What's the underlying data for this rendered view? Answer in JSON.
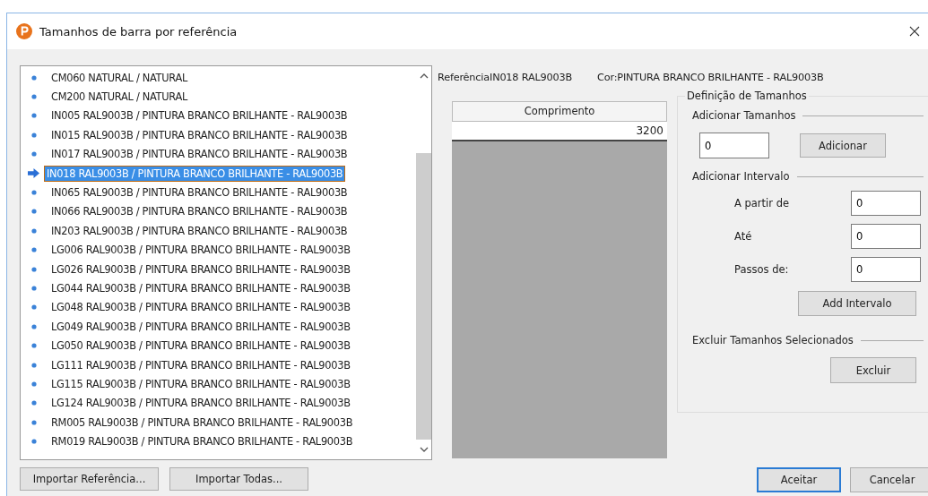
{
  "window": {
    "title": "Tamanhos de barra por referência"
  },
  "list": {
    "items": [
      {
        "label": "CM060 NATURAL / NATURAL",
        "selected": false
      },
      {
        "label": "CM200 NATURAL / NATURAL",
        "selected": false
      },
      {
        "label": "IN005 RAL9003B / PINTURA BRANCO BRILHANTE - RAL9003B",
        "selected": false
      },
      {
        "label": "IN015 RAL9003B / PINTURA BRANCO BRILHANTE - RAL9003B",
        "selected": false
      },
      {
        "label": "IN017 RAL9003B / PINTURA BRANCO BRILHANTE - RAL9003B",
        "selected": false
      },
      {
        "label": "IN018 RAL9003B / PINTURA BRANCO BRILHANTE - RAL9003B",
        "selected": true
      },
      {
        "label": "IN065 RAL9003B / PINTURA BRANCO BRILHANTE - RAL9003B",
        "selected": false
      },
      {
        "label": "IN066 RAL9003B / PINTURA BRANCO BRILHANTE - RAL9003B",
        "selected": false
      },
      {
        "label": "IN203 RAL9003B / PINTURA BRANCO BRILHANTE - RAL9003B",
        "selected": false
      },
      {
        "label": "LG006 RAL9003B / PINTURA BRANCO BRILHANTE - RAL9003B",
        "selected": false
      },
      {
        "label": "LG026 RAL9003B / PINTURA BRANCO BRILHANTE - RAL9003B",
        "selected": false
      },
      {
        "label": "LG044 RAL9003B / PINTURA BRANCO BRILHANTE - RAL9003B",
        "selected": false
      },
      {
        "label": "LG048 RAL9003B / PINTURA BRANCO BRILHANTE - RAL9003B",
        "selected": false
      },
      {
        "label": "LG049 RAL9003B / PINTURA BRANCO BRILHANTE - RAL9003B",
        "selected": false
      },
      {
        "label": "LG050 RAL9003B / PINTURA BRANCO BRILHANTE - RAL9003B",
        "selected": false
      },
      {
        "label": "LG111 RAL9003B / PINTURA BRANCO BRILHANTE - RAL9003B",
        "selected": false
      },
      {
        "label": "LG115 RAL9003B / PINTURA BRANCO BRILHANTE - RAL9003B",
        "selected": false
      },
      {
        "label": "LG124 RAL9003B / PINTURA BRANCO BRILHANTE - RAL9003B",
        "selected": false
      },
      {
        "label": "RM005 RAL9003B / PINTURA BRANCO BRILHANTE - RAL9003B",
        "selected": false
      },
      {
        "label": "RM019 RAL9003B / PINTURA BRANCO BRILHANTE - RAL9003B",
        "selected": false
      }
    ]
  },
  "reference_label": "ReferênciaIN018 RAL9003B",
  "color_label": "Cor:PINTURA BRANCO BRILHANTE - RAL9003B",
  "table": {
    "columns": [
      "Comprimento"
    ],
    "rows": [
      [
        "3200"
      ]
    ]
  },
  "sizes_group": {
    "title": "Definição de Tamanhos",
    "add_sizes": {
      "title": "Adicionar Tamanhos",
      "value": "0",
      "button": "Adicionar"
    },
    "add_interval": {
      "title": "Adicionar Intervalo",
      "fields": [
        {
          "label": "A partir de",
          "value": "0"
        },
        {
          "label": "Até",
          "value": "0"
        },
        {
          "label": "Passos de:",
          "value": "0"
        }
      ],
      "button": "Add Intervalo"
    },
    "delete": {
      "title": "Excluir Tamanhos Selecionados",
      "button": "Excluir"
    }
  },
  "import_buttons": [
    "Importar Referência...",
    "Importar Todas..."
  ],
  "dialog_buttons": [
    {
      "label": "Aceitar",
      "default": true
    },
    {
      "label": "Cancelar",
      "default": false
    }
  ]
}
